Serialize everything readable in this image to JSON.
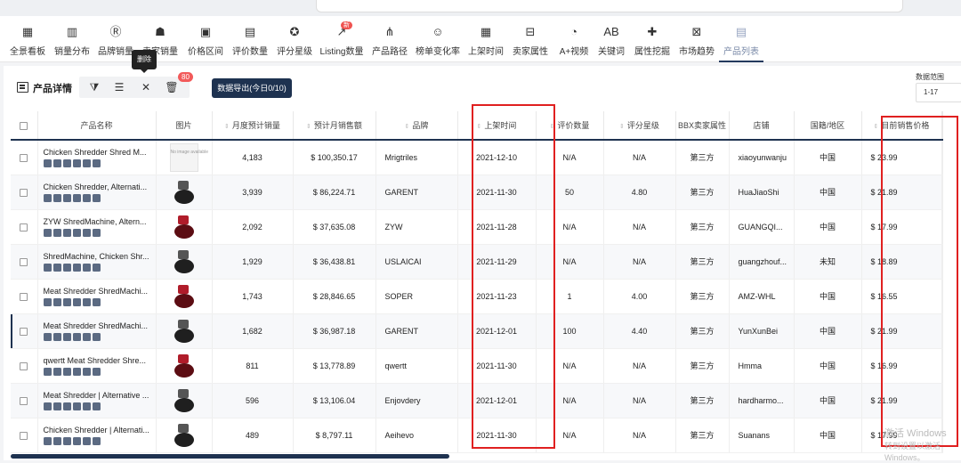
{
  "nav": {
    "items": [
      {
        "label": "全景看板",
        "icon": "dashboard-icon",
        "glyph": "▦"
      },
      {
        "label": "销量分布",
        "icon": "bar-chart-icon",
        "glyph": "▥"
      },
      {
        "label": "品牌销量",
        "icon": "brand-r-icon",
        "glyph": "Ⓡ"
      },
      {
        "label": "卖家销量",
        "icon": "seller-icon",
        "glyph": "☗"
      },
      {
        "label": "价格区间",
        "icon": "price-range-icon",
        "glyph": "▣"
      },
      {
        "label": "评价数量",
        "icon": "review-count-icon",
        "glyph": "▤"
      },
      {
        "label": "评分星级",
        "icon": "star-icon",
        "glyph": "✪"
      },
      {
        "label": "Listing数量",
        "icon": "listing-trend-icon",
        "glyph": "↗",
        "badge": "新"
      },
      {
        "label": "产品路径",
        "icon": "path-icon",
        "glyph": "⋔"
      },
      {
        "label": "榜单变化率",
        "icon": "rank-change-icon",
        "glyph": "☺"
      },
      {
        "label": "上架时间",
        "icon": "calendar-icon",
        "glyph": "▦"
      },
      {
        "label": "卖家属性",
        "icon": "store-icon",
        "glyph": "⊟"
      },
      {
        "label": "A+视频",
        "icon": "video-pie-icon",
        "glyph": "◔"
      },
      {
        "label": "关键词",
        "icon": "keyword-icon",
        "glyph": "AB"
      },
      {
        "label": "属性挖掘",
        "icon": "puzzle-icon",
        "glyph": "✚"
      },
      {
        "label": "市场趋势",
        "icon": "trend-icon",
        "glyph": "⊠"
      },
      {
        "label": "产品列表",
        "icon": "product-list-icon",
        "glyph": "▤",
        "active": true
      }
    ]
  },
  "panel": {
    "title": "产品详情",
    "delete_tooltip": "删除",
    "badge_count": "80",
    "export_label": "数据导出(今日0/10)",
    "range_label": "数据范围",
    "range_value": "1-17"
  },
  "table": {
    "headers": [
      "产品名称",
      "图片",
      "月度预计销量",
      "预计月销售额",
      "品牌",
      "上架时间",
      "评价数量",
      "评分星级",
      "BBX卖家属性",
      "店铺",
      "国籍/地区",
      "目前销售价格"
    ],
    "rows": [
      {
        "name": "Chicken Shredder Shred M...",
        "img": "na",
        "sales": "4,183",
        "revenue": "$ 100,350.17",
        "brand": "Mrigtriles",
        "date": "2021-12-10",
        "reviews": "N/A",
        "rating": "N/A",
        "seller": "第三方",
        "store": "xiaoyunwanju",
        "country": "中国",
        "price": "$ 23.99"
      },
      {
        "name": "Chicken Shredder, Alternati...",
        "img": "black",
        "sales": "3,939",
        "revenue": "$ 86,224.71",
        "brand": "GARENT",
        "date": "2021-11-30",
        "reviews": "50",
        "rating": "4.80",
        "seller": "第三方",
        "store": "HuaJiaoShi",
        "country": "中国",
        "price": "$ 21.89"
      },
      {
        "name": "ZYW ShredMachine, Altern...",
        "img": "red",
        "sales": "2,092",
        "revenue": "$ 37,635.08",
        "brand": "ZYW",
        "date": "2021-11-28",
        "reviews": "N/A",
        "rating": "N/A",
        "seller": "第三方",
        "store": "GUANGQI...",
        "country": "中国",
        "price": "$ 17.99"
      },
      {
        "name": "ShredMachine, Chicken Shr...",
        "img": "black",
        "sales": "1,929",
        "revenue": "$ 36,438.81",
        "brand": "USLAICAI",
        "date": "2021-11-29",
        "reviews": "N/A",
        "rating": "N/A",
        "seller": "第三方",
        "store": "guangzhouf...",
        "country": "未知",
        "price": "$ 18.89"
      },
      {
        "name": "Meat Shredder ShredMachi...",
        "img": "red",
        "sales": "1,743",
        "revenue": "$ 28,846.65",
        "brand": "SOPER",
        "date": "2021-11-23",
        "reviews": "1",
        "rating": "4.00",
        "seller": "第三方",
        "store": "AMZ-WHL",
        "country": "中国",
        "price": "$ 16.55"
      },
      {
        "name": "Meat Shredder ShredMachi...",
        "img": "black",
        "sales": "1,682",
        "revenue": "$ 36,987.18",
        "brand": "GARENT",
        "date": "2021-12-01",
        "reviews": "100",
        "rating": "4.40",
        "seller": "第三方",
        "store": "YunXunBei",
        "country": "中国",
        "price": "$ 21.99"
      },
      {
        "name": "qwertt Meat Shredder Shre...",
        "img": "red",
        "sales": "811",
        "revenue": "$ 13,778.89",
        "brand": "qwertt",
        "date": "2021-11-30",
        "reviews": "N/A",
        "rating": "N/A",
        "seller": "第三方",
        "store": "Hmma",
        "country": "中国",
        "price": "$ 16.99"
      },
      {
        "name": "Meat Shredder | Alternative ...",
        "img": "black",
        "sales": "596",
        "revenue": "$ 13,106.04",
        "brand": "Enjovdery",
        "date": "2021-12-01",
        "reviews": "N/A",
        "rating": "N/A",
        "seller": "第三方",
        "store": "hardharmo...",
        "country": "中国",
        "price": "$ 21.99"
      },
      {
        "name": "Chicken Shredder | Alternati...",
        "img": "black",
        "sales": "489",
        "revenue": "$ 8,797.11",
        "brand": "Aeihevo",
        "date": "2021-11-30",
        "reviews": "N/A",
        "rating": "N/A",
        "seller": "第三方",
        "store": "Suanans",
        "country": "中国",
        "price": "$ 17.99"
      }
    ]
  },
  "no_image_text": "No image available",
  "watermark": {
    "line1": "激活 Windows",
    "line2": "转到设置以激活 Windows。"
  }
}
